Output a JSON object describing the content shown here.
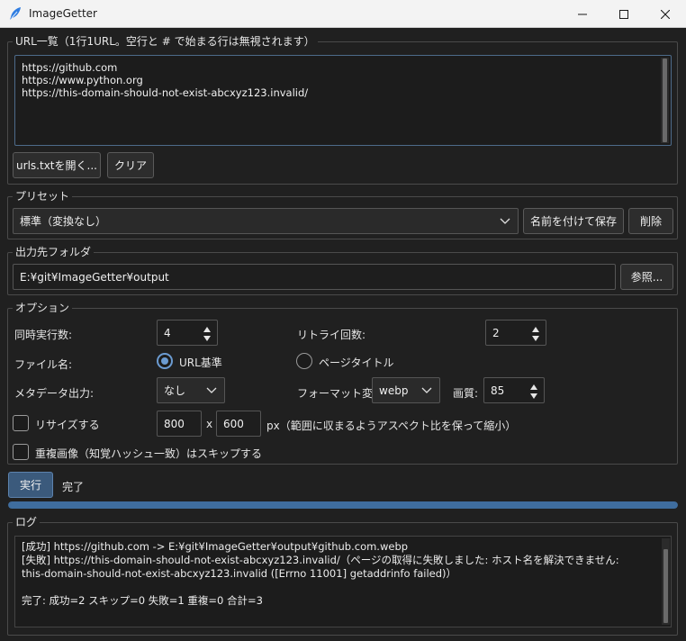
{
  "window": {
    "title": "ImageGetter"
  },
  "urls": {
    "legend": "URL一覧（1行1URL。空行と # で始まる行は無視されます）",
    "lines": [
      "https://github.com",
      "https://www.python.org",
      "https://this-domain-should-not-exist-abcxyz123.invalid/"
    ],
    "open_button": "urls.txtを開く...",
    "clear_button": "クリア"
  },
  "preset": {
    "legend": "プリセット",
    "selected": "標準（変換なし）",
    "save_as_button": "名前を付けて保存",
    "delete_button": "削除"
  },
  "output": {
    "legend": "出力先フォルダ",
    "path": "E:¥git¥ImageGetter¥output",
    "browse_button": "参照..."
  },
  "options": {
    "legend": "オプション",
    "concurrency_label": "同時実行数:",
    "concurrency_value": "4",
    "retry_label": "リトライ回数:",
    "retry_value": "2",
    "filename_label": "ファイル名:",
    "filename_url": "URL基準",
    "filename_title": "ページタイトル",
    "filename_selected": "URL基準",
    "metadata_label": "メタデータ出力:",
    "metadata_value": "なし",
    "format_label": "フォーマット変換:",
    "format_value": "webp",
    "quality_label": "画質:",
    "quality_value": "85",
    "resize_label": "リサイズする",
    "resize_checked": false,
    "resize_width": "800",
    "resize_x": "x",
    "resize_height": "600",
    "resize_hint": "px（範囲に収まるようアスペクト比を保って縮小）",
    "dedupe_label": "重複画像（知覚ハッシュ一致）はスキップする",
    "dedupe_checked": false
  },
  "run": {
    "button": "実行",
    "status": "完了",
    "progress": 1.0
  },
  "log": {
    "legend": "ログ",
    "lines": [
      "[成功] https://github.com -> E:¥git¥ImageGetter¥output¥github.com.webp",
      "[失敗] https://this-domain-should-not-exist-abcxyz123.invalid/（ページの取得に失敗しました: ホスト名を解決できません:",
      "this-domain-should-not-exist-abcxyz123.invalid ([Errno 11001] getaddrinfo failed)）",
      "",
      "完了: 成功=2 スキップ=0 失敗=1 重複=0 合計=3"
    ]
  },
  "colors": {
    "background": "#202020",
    "accent": "#6b9bd1",
    "primary_button": "#3b5a7c",
    "progress": "#3f6d9e"
  }
}
